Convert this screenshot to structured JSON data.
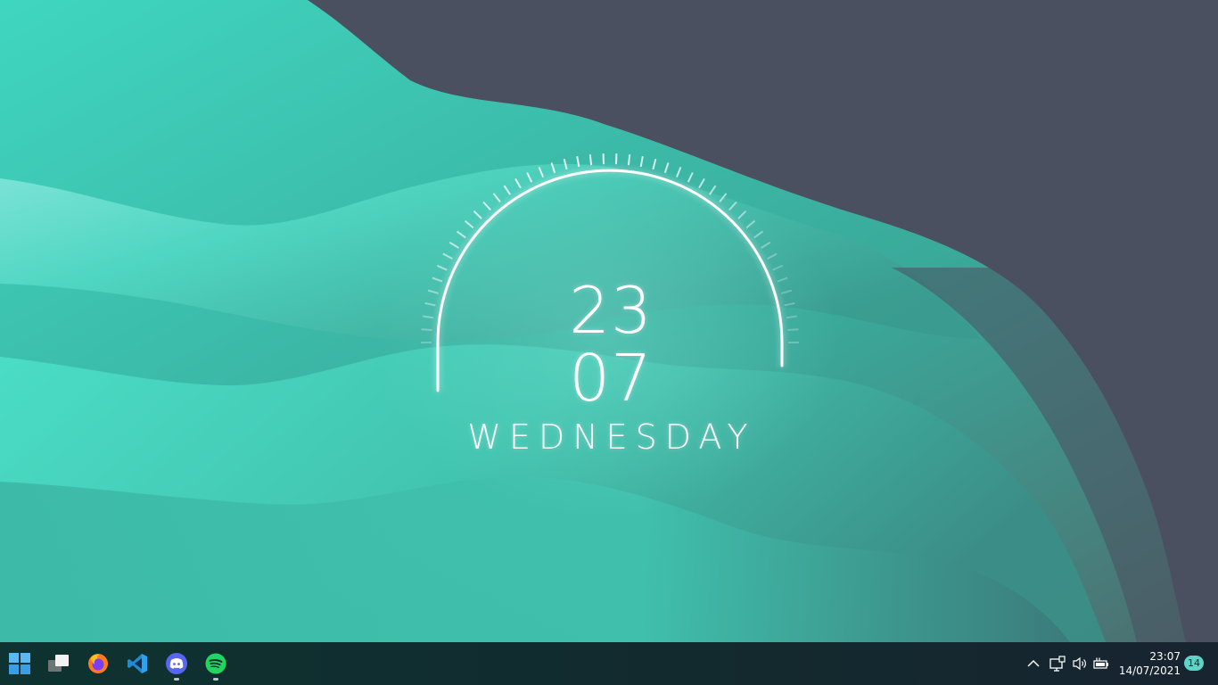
{
  "clock_widget": {
    "hours": "23",
    "minutes": "07",
    "day": "WEDNESDAY"
  },
  "taskbar": {
    "pinned_apps": [
      {
        "name": "Start",
        "icon": "windows-logo-icon"
      },
      {
        "name": "Task View",
        "icon": "task-view-icon"
      },
      {
        "name": "Firefox",
        "icon": "firefox-icon"
      },
      {
        "name": "Visual Studio Code",
        "icon": "vscode-icon"
      },
      {
        "name": "Discord",
        "icon": "discord-icon",
        "running": true
      },
      {
        "name": "Spotify",
        "icon": "spotify-icon",
        "running": true
      }
    ],
    "tray": {
      "overflow_icon": "chevron-up-icon",
      "network_icon": "network-icon",
      "volume_icon": "volume-icon",
      "battery_icon": "battery-charging-icon",
      "time": "23:07",
      "date": "14/07/2021",
      "notification_count": "14"
    }
  },
  "colors": {
    "wallpaper_teal": "#46d8c2",
    "wallpaper_slate": "#4a5060",
    "taskbar": "#0f2b2c",
    "badge": "#5fd3c6"
  }
}
